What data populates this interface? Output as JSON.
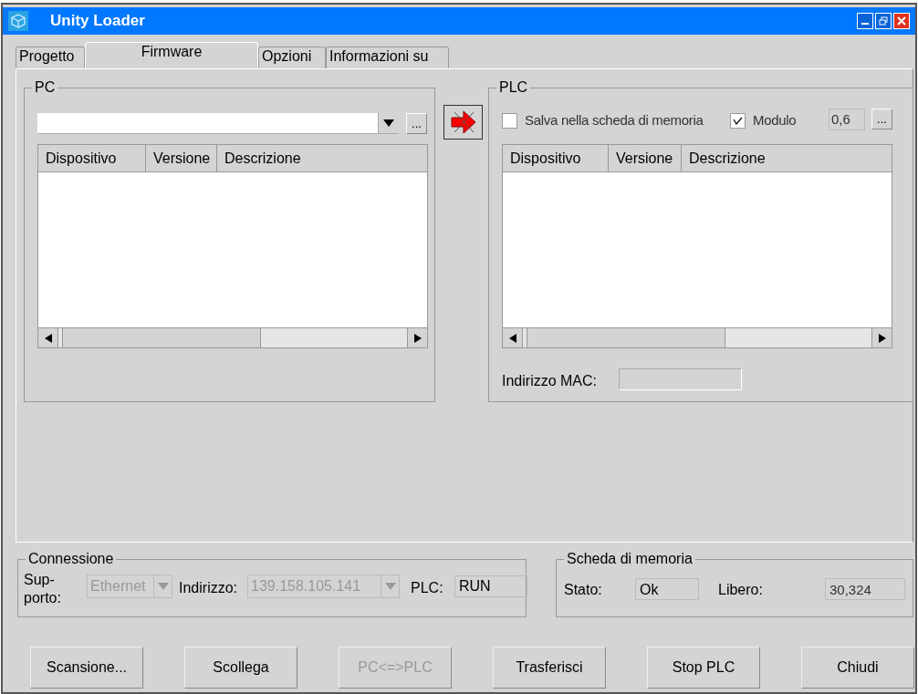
{
  "window": {
    "title": "Unity Loader"
  },
  "tabs": [
    {
      "label": "Progetto",
      "selected": false
    },
    {
      "label": "Firmware",
      "selected": true
    },
    {
      "label": "Opzioni",
      "selected": false
    },
    {
      "label": "Informazioni su",
      "selected": false
    }
  ],
  "pc": {
    "title": "PC",
    "browse_label": "...",
    "columns": [
      "Dispositivo",
      "Versione",
      "Descrizione"
    ]
  },
  "plc": {
    "title": "PLC",
    "checkboxes": [
      {
        "label": "Salva nella scheda di memoria",
        "checked": false
      },
      {
        "label": "Modulo",
        "checked": true
      }
    ],
    "module_value": "0,6",
    "browse_label": "...",
    "columns": [
      "Dispositivo",
      "Versione",
      "Descrizione"
    ],
    "mac_label": "Indirizzo MAC:"
  },
  "connection": {
    "title": "Connessione",
    "support_label": "Sup-\nporto:",
    "support_value": "Ethernet",
    "support_disabled": true,
    "address_label": "Indirizzo:",
    "address_value": "139.158.105.141",
    "address_disabled": true,
    "plc_label": "PLC:",
    "plc_value": "RUN"
  },
  "memory_card": {
    "title": "Scheda di memoria",
    "state_label": "Stato:",
    "state_value": "Ok",
    "free_label": "Libero:",
    "free_value": "30,324"
  },
  "buttons": [
    {
      "label": "Scansione...",
      "disabled": false
    },
    {
      "label": "Scollega",
      "disabled": false
    },
    {
      "label": "PC<=>PLC",
      "disabled": true
    },
    {
      "label": "Trasferisci",
      "disabled": false
    },
    {
      "label": "Stop PLC",
      "disabled": false
    },
    {
      "label": "Chiudi",
      "disabled": false
    }
  ]
}
